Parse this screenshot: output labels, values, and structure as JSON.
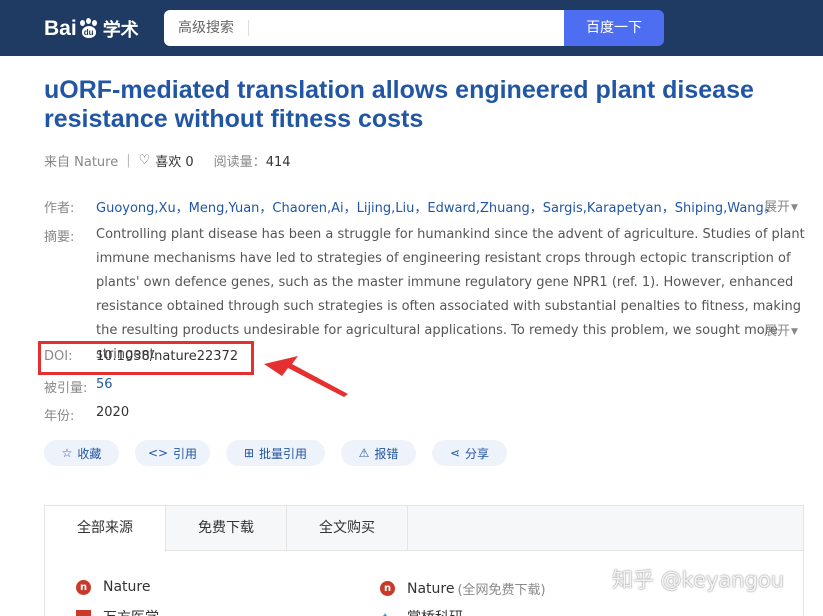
{
  "header": {
    "logo_bai": "Bai",
    "logo_du": "du",
    "logo_xueshu": "学术",
    "advanced_search_label": "高级搜索",
    "search_value": "",
    "search_button_label": "百度一下"
  },
  "paper": {
    "title": "uORF-mediated translation allows engineered plant disease resistance without fitness costs",
    "source_text": "来自 Nature",
    "like_text": "喜欢 0",
    "reads_label": "阅读量：",
    "reads_value": "414"
  },
  "fields": {
    "authors_label": "作者:",
    "authors_value": "Guoyong,Xu，Meng,Yuan，Chaoren,Ai，Lijing,Liu，Edward,Zhuang，Sargis,Karapetyan，Shiping,Wang，",
    "abstract_label": "摘要:",
    "abstract_value": "Controlling plant disease has been a struggle for humankind since the advent of agriculture. Studies of plant immune mechanisms have led to strategies of engineering resistant crops through ectopic transcription of plants' own defence genes, such as the master immune regulatory gene NPR1 (ref. 1). However, enhanced resistance obtained through such strategies is often associated with substantial penalties to fitness, making the resulting products undesirable for agricultural applications. To remedy this problem, we sought more stringent",
    "expand_label": "展开",
    "doi_label": "DOI:",
    "doi_value": "10.1038/nature22372",
    "cited_label": "被引量:",
    "cited_value": "56",
    "year_label": "年份:",
    "year_value": "2020"
  },
  "actions": {
    "collect": "收藏",
    "cite": "引用",
    "batch_cite": "批量引用",
    "report": "报错",
    "share": "分享"
  },
  "sources": {
    "tabs": [
      "全部来源",
      "免费下载",
      "全文购买"
    ],
    "items": [
      {
        "name": "Nature",
        "note": ""
      },
      {
        "name": "Nature",
        "note": "(全网免费下载)"
      },
      {
        "name": "万方医学",
        "note": ""
      },
      {
        "name": "掌桥科研",
        "note": ""
      }
    ]
  },
  "watermark": "知乎 @keyangou",
  "colors": {
    "header_bg": "#1f3b64",
    "accent_blue": "#2156a5",
    "search_button": "#4e6ef2",
    "highlight_red": "#e53030"
  }
}
